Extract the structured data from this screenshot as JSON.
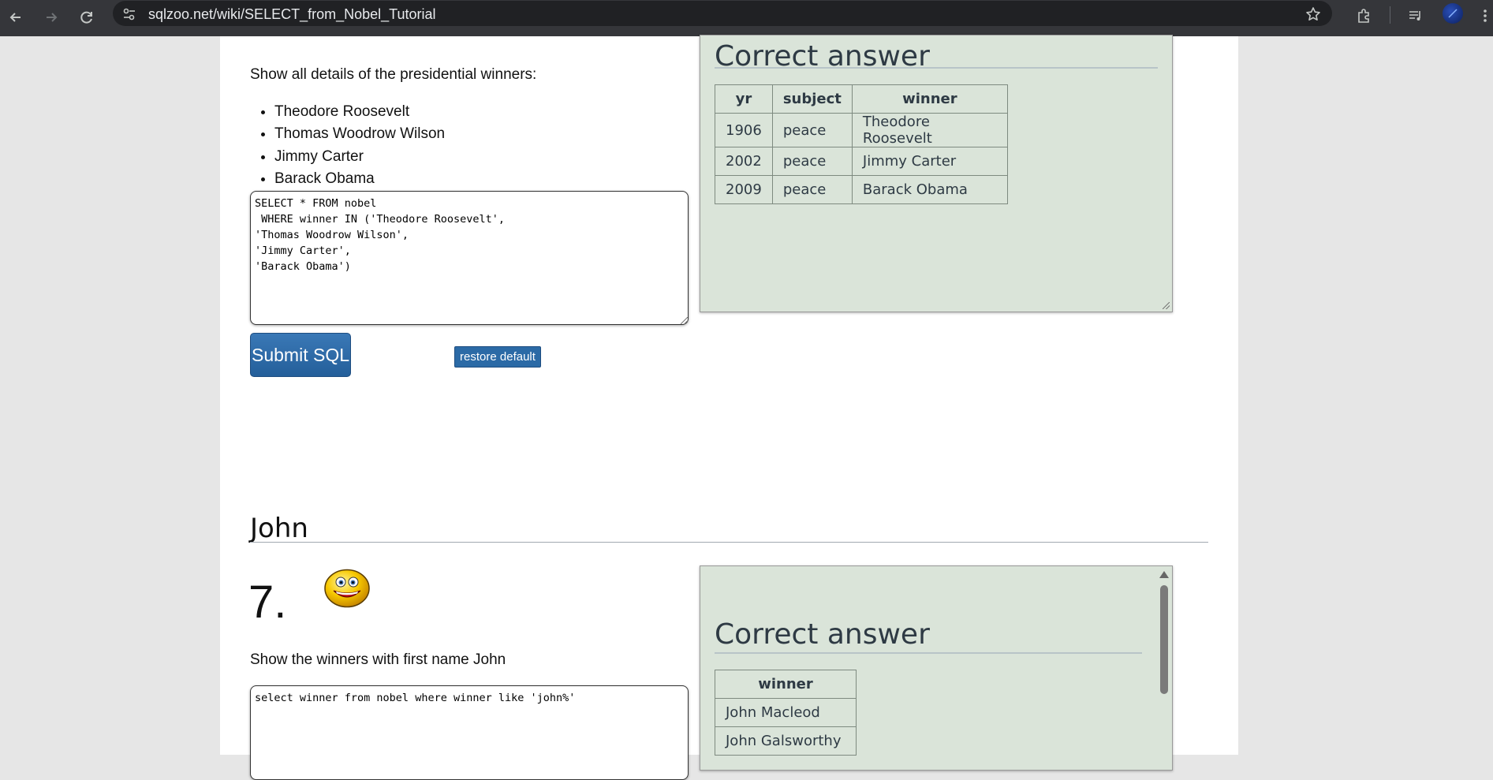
{
  "browser": {
    "url": "sqlzoo.net/wiki/SELECT_from_Nobel_Tutorial"
  },
  "q6": {
    "question": "Show all details of the presidential winners:",
    "bullets": [
      "Theodore Roosevelt",
      "Thomas Woodrow Wilson",
      "Jimmy Carter",
      "Barack Obama"
    ],
    "sql": "SELECT * FROM nobel\n WHERE winner IN ('Theodore Roosevelt',\n'Thomas Woodrow Wilson',\n'Jimmy Carter',\n'Barack Obama')",
    "submit_label": "Submit SQL",
    "restore_label": "restore default",
    "answer": {
      "title": "Correct answer",
      "columns": [
        "yr",
        "subject",
        "winner"
      ],
      "rows": [
        [
          "1906",
          "peace",
          "Theodore Roosevelt"
        ],
        [
          "2002",
          "peace",
          "Jimmy Carter"
        ],
        [
          "2009",
          "peace",
          "Barack Obama"
        ]
      ]
    }
  },
  "section": {
    "heading": "John"
  },
  "q7": {
    "number": "7.",
    "question": "Show the winners with first name John",
    "sql": "select winner from nobel where winner like 'john%'",
    "answer": {
      "title": "Correct answer",
      "columns": [
        "winner"
      ],
      "rows": [
        [
          "John Macleod"
        ],
        [
          "John Galsworthy"
        ]
      ]
    }
  }
}
